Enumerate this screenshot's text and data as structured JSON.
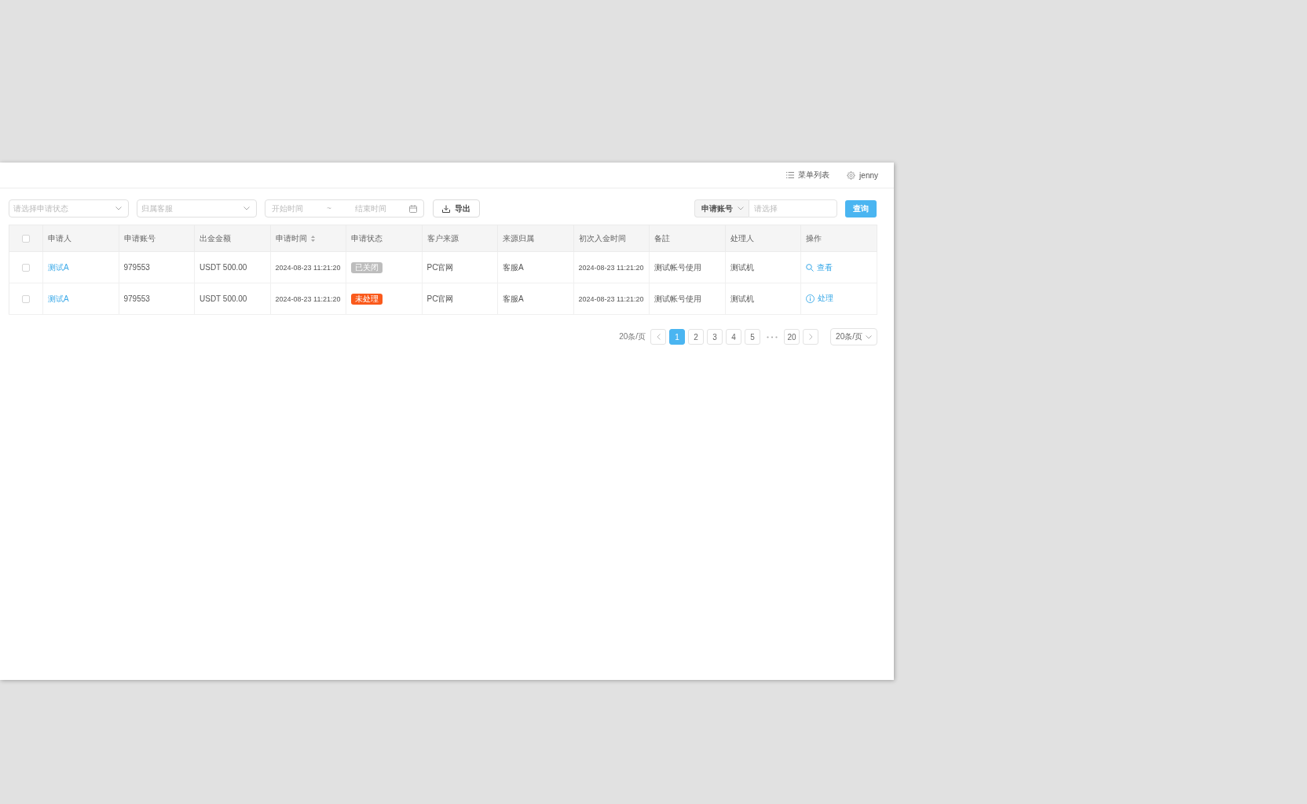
{
  "header": {
    "menu_label": "菜单列表",
    "user": "jenny"
  },
  "filters": {
    "status_select": {
      "placeholder": "请选择申请状态"
    },
    "agent_select": {
      "placeholder": "归属客服"
    },
    "date_range": {
      "start_placeholder": "开始时间",
      "separator": "~",
      "end_placeholder": "结束时间"
    },
    "export_button": "导出",
    "account_search": {
      "type": "申请账号",
      "placeholder": "请选择"
    },
    "query_button": "查询"
  },
  "table": {
    "select_all_checked": false,
    "columns": [
      {
        "label": "申请人",
        "sortable": false
      },
      {
        "label": "申请账号",
        "sortable": false
      },
      {
        "label": "出金金额",
        "sortable": false
      },
      {
        "label": "申请时间",
        "sortable": true
      },
      {
        "label": "申请状态",
        "sortable": false
      },
      {
        "label": "客户来源",
        "sortable": false
      },
      {
        "label": "来源归属",
        "sortable": false
      },
      {
        "label": "初次入金时间",
        "sortable": false
      },
      {
        "label": "备註",
        "sortable": false
      },
      {
        "label": "处理人",
        "sortable": false
      },
      {
        "label": "操作",
        "sortable": false
      }
    ],
    "rows": [
      {
        "checked": false,
        "applicant": "测试A",
        "account": "979553",
        "amount": "USDT 500.00",
        "applied_at": "2024-08-23 11:21:20",
        "status": {
          "label": "已关闭",
          "color": "#bdbdbd"
        },
        "source": "PC官网",
        "owner": "客服A",
        "first_deposit_at": "2024-08-23 11:21:20",
        "note": "测试帐号使用",
        "handler": "测试机",
        "action": {
          "kind": "view",
          "label": "查看"
        }
      },
      {
        "checked": false,
        "applicant": "测试A",
        "account": "979553",
        "amount": "USDT 500.00",
        "applied_at": "2024-08-23 11:21:20",
        "status": {
          "label": "未处理",
          "color": "#fa5a1c"
        },
        "source": "PC官网",
        "owner": "客服A",
        "first_deposit_at": "2024-08-23 11:21:20",
        "note": "测试帐号使用",
        "handler": "测试机",
        "action": {
          "kind": "process",
          "label": "处理"
        }
      }
    ]
  },
  "pagination": {
    "summary": "20条/页",
    "pages": [
      {
        "kind": "page",
        "label": "1",
        "selected": true
      },
      {
        "kind": "page",
        "label": "2",
        "selected": false
      },
      {
        "kind": "page",
        "label": "3",
        "selected": false
      },
      {
        "kind": "page",
        "label": "4",
        "selected": false
      },
      {
        "kind": "page",
        "label": "5",
        "selected": false
      },
      {
        "kind": "ellipsis"
      },
      {
        "kind": "page",
        "label": "20",
        "selected": false
      }
    ],
    "page_size": "20条/页"
  }
}
